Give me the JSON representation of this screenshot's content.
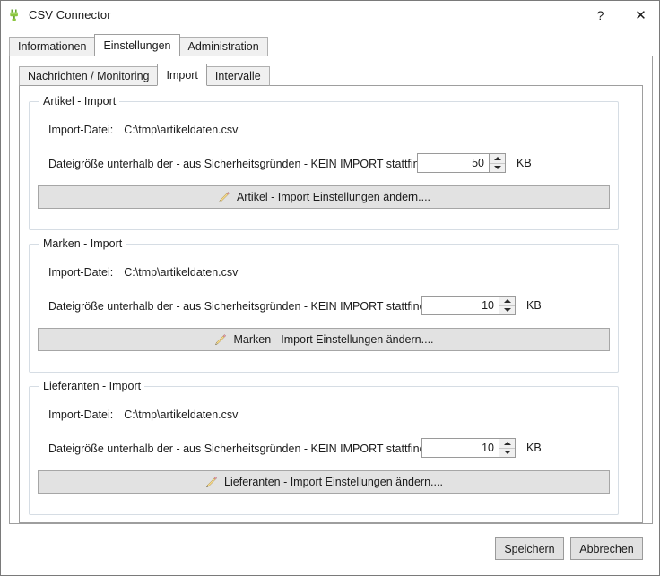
{
  "window": {
    "title": "CSV Connector",
    "icon": "plug-icon",
    "help_label": "?",
    "close_label": "✕",
    "accent_icon_color": "#7ab648"
  },
  "outer_tabs": [
    {
      "label": "Informationen",
      "selected": false
    },
    {
      "label": "Einstellungen",
      "selected": true
    },
    {
      "label": "Administration",
      "selected": false
    }
  ],
  "inner_tabs": [
    {
      "label": "Nachrichten / Monitoring",
      "selected": false
    },
    {
      "label": "Import",
      "selected": true
    },
    {
      "label": "Intervalle",
      "selected": false
    }
  ],
  "groups": [
    {
      "title": "Artikel - Import",
      "file_label": "Import-Datei:",
      "file_value": "C:\\tmp\\artikeldaten.csv",
      "size_label": "Dateigröße unterhalb der - aus Sicherheitsgründen - KEIN IMPORT stattfindet:",
      "size_value": "50",
      "size_unit": "KB",
      "button_label": "Artikel - Import Einstellungen ändern...."
    },
    {
      "title": "Marken - Import",
      "file_label": "Import-Datei:",
      "file_value": "C:\\tmp\\artikeldaten.csv",
      "size_label": "Dateigröße unterhalb der - aus Sicherheitsgründen - KEIN IMPORT stattfindet:",
      "size_value": "10",
      "size_unit": "KB",
      "button_label": "Marken - Import Einstellungen ändern...."
    },
    {
      "title": "Lieferanten - Import",
      "file_label": "Import-Datei:",
      "file_value": "C:\\tmp\\artikeldaten.csv",
      "size_label": "Dateigröße unterhalb der - aus Sicherheitsgründen - KEIN IMPORT stattfindet:",
      "size_value": "10",
      "size_unit": "KB",
      "button_label": "Lieferanten - Import Einstellungen ändern...."
    }
  ],
  "footer": {
    "save_label": "Speichern",
    "cancel_label": "Abbrechen"
  }
}
